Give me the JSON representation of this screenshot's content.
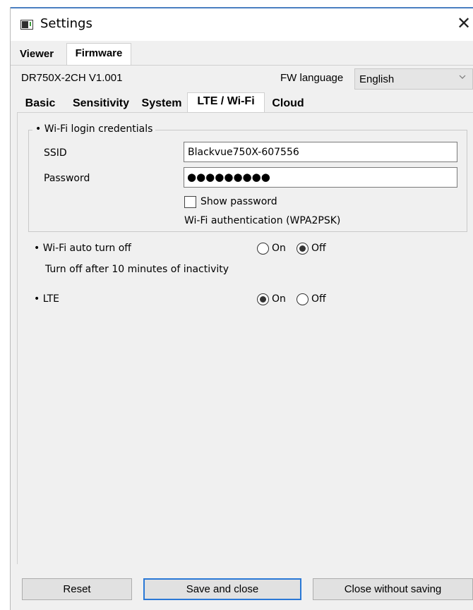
{
  "window": {
    "title": "Settings",
    "close_glyph": "✕"
  },
  "top_tabs": [
    {
      "label": "Viewer"
    },
    {
      "label": "Firmware"
    }
  ],
  "firmware": {
    "model": "DR750X-2CH V1.001",
    "language_label": "FW language",
    "language_value": "English"
  },
  "sub_tabs": [
    {
      "label": "Basic"
    },
    {
      "label": "Sensitivity"
    },
    {
      "label": "System"
    },
    {
      "label": "LTE / Wi-Fi"
    },
    {
      "label": "Cloud"
    }
  ],
  "wifi_login": {
    "legend": "• Wi-Fi login credentials",
    "ssid_label": "SSID",
    "ssid_value": "Blackvue750X-607556",
    "password_label": "Password",
    "password_mask": "●●●●●●●●●",
    "show_password_label": "Show password",
    "show_password_checked": false,
    "auth_text": "Wi-Fi authentication (WPA2PSK)"
  },
  "wifi_auto_off": {
    "label": "• Wi-Fi auto turn off",
    "on_label": "On",
    "off_label": "Off",
    "selected": "Off",
    "note": "Turn off after 10 minutes of inactivity"
  },
  "lte": {
    "label": "• LTE",
    "on_label": "On",
    "off_label": "Off",
    "selected": "On"
  },
  "buttons": {
    "reset": "Reset",
    "save": "Save and close",
    "close": "Close without saving"
  },
  "colors": {
    "accent": "#2a78d6",
    "window_bg": "#f0f0f0"
  }
}
